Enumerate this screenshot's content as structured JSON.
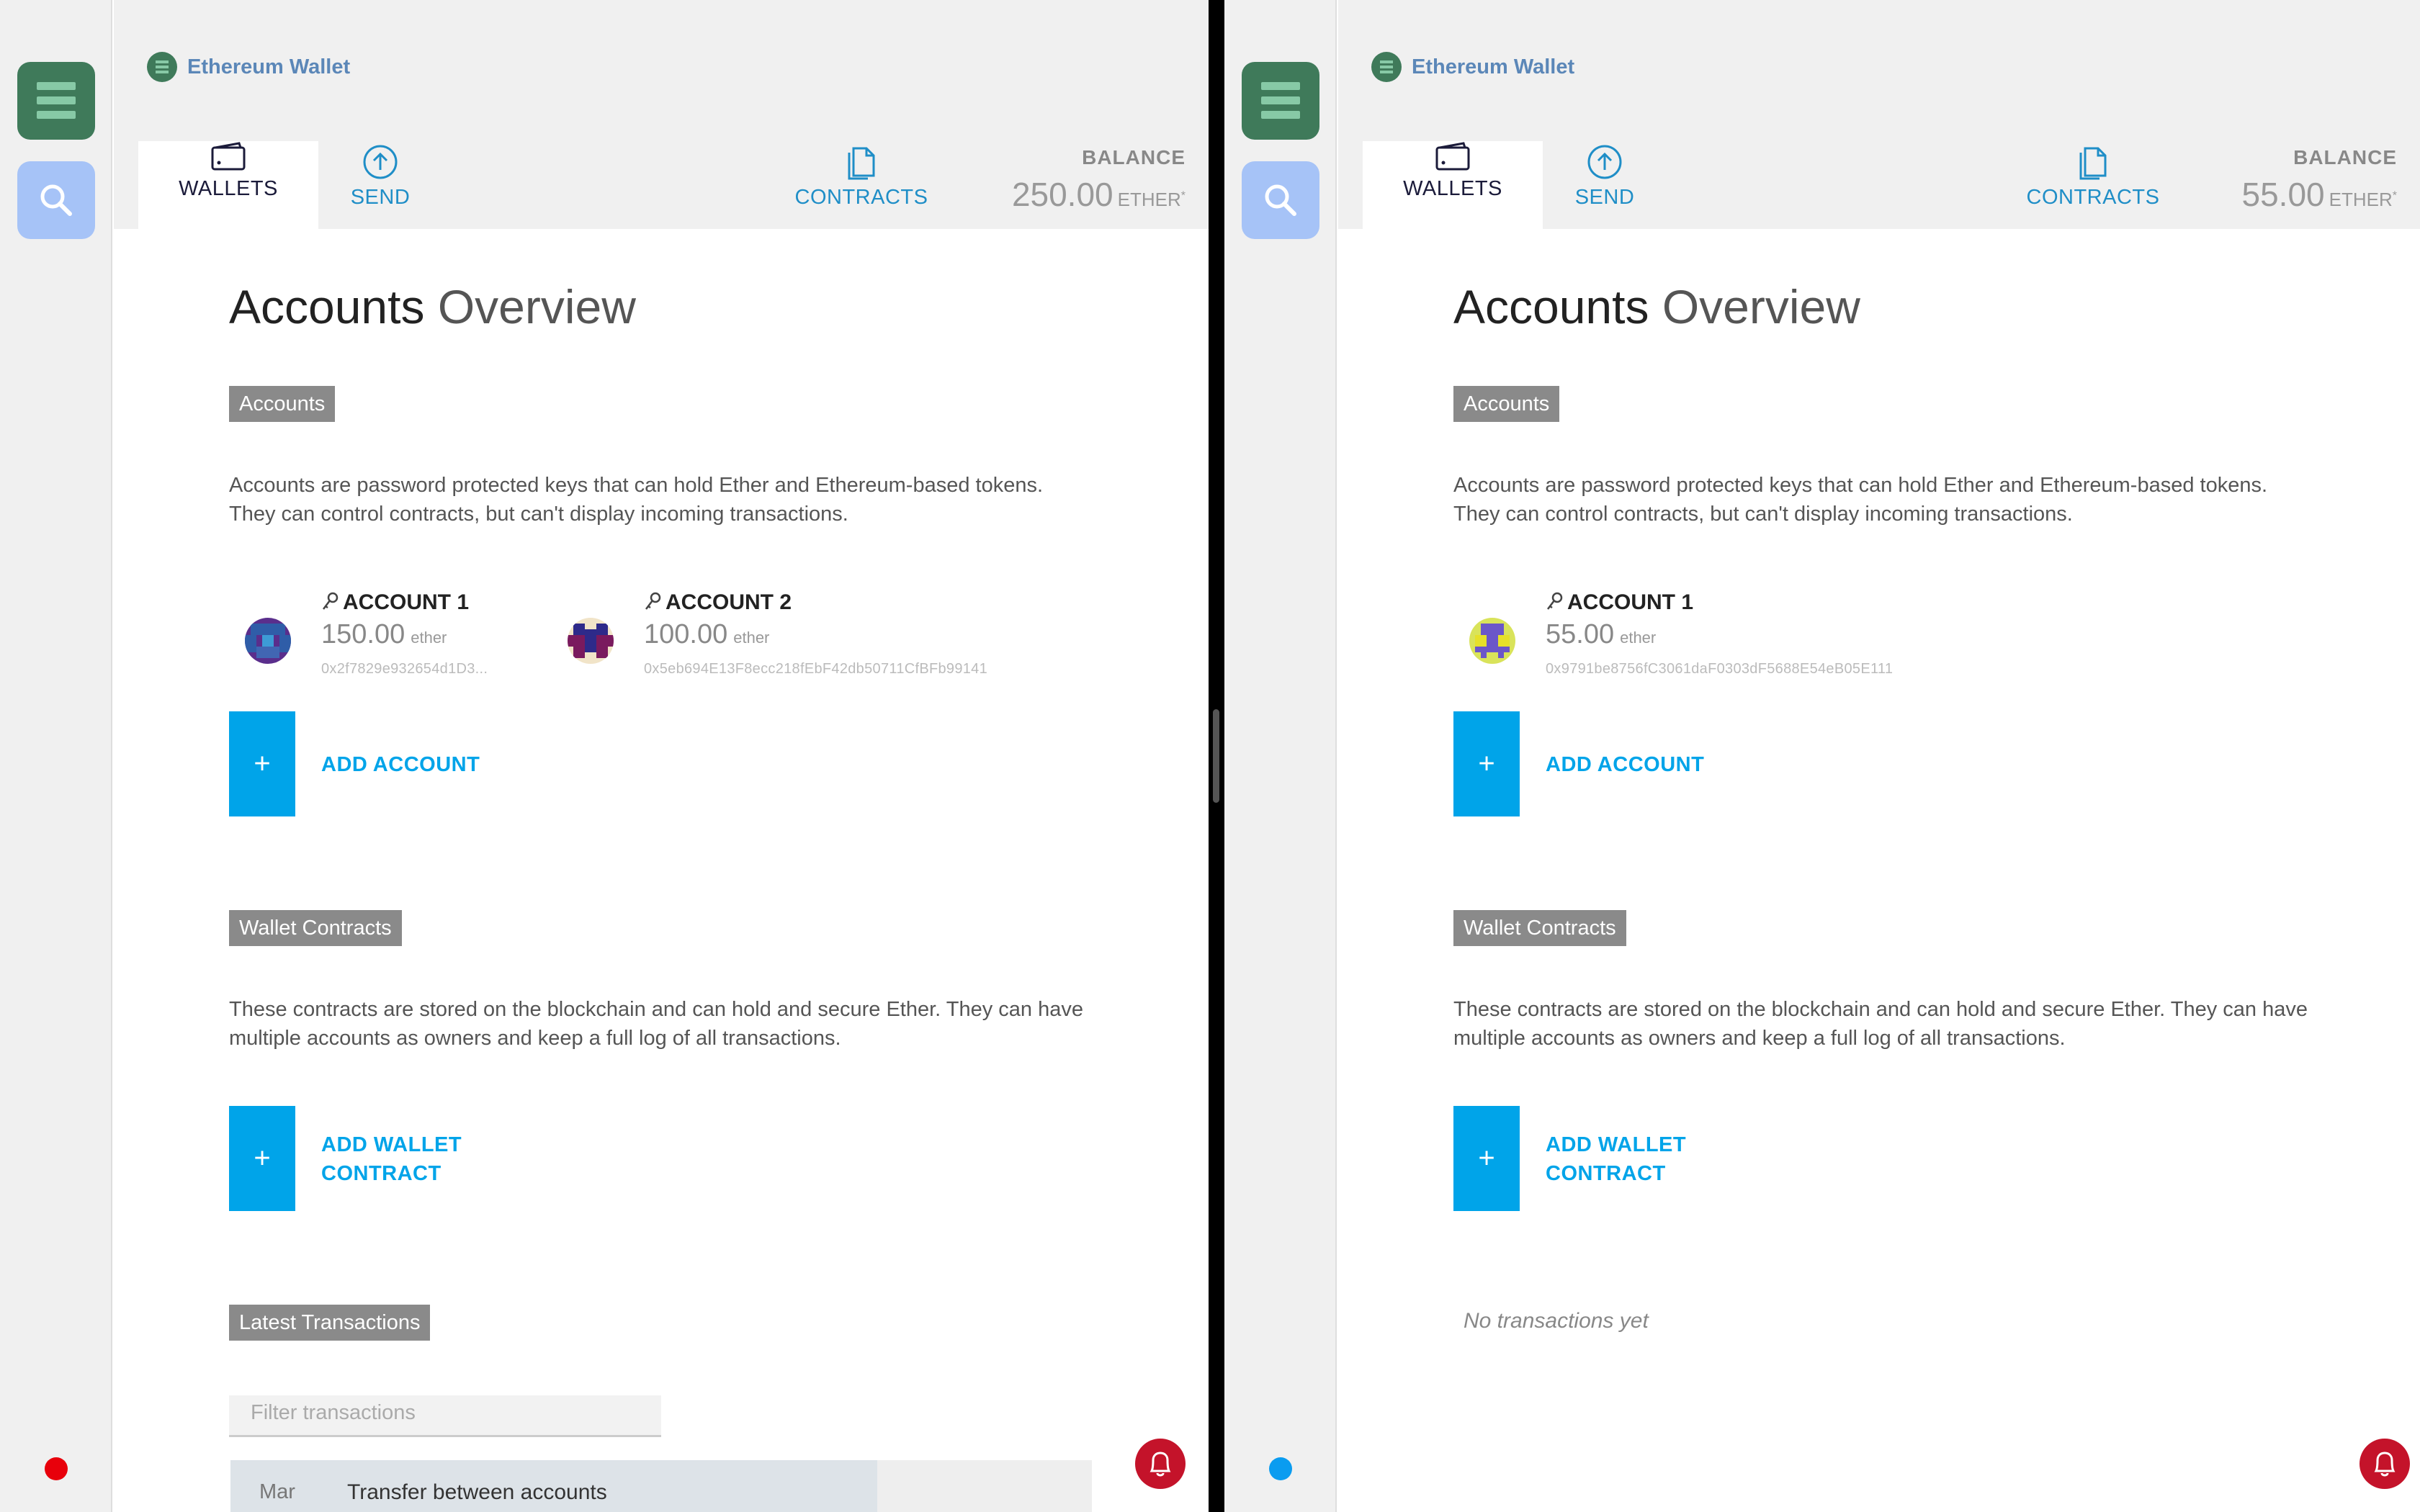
{
  "left": {
    "brand": "Ethereum Wallet",
    "nav": {
      "wallets": "WALLETS",
      "send": "SEND",
      "contracts": "CONTRACTS"
    },
    "balance": {
      "label": "BALANCE",
      "value": "250.00",
      "unit": "ETHER",
      "unit_mark": "*"
    },
    "title": {
      "bold": "Accounts",
      "light": "Overview"
    },
    "accounts_label": "Accounts",
    "accounts_desc": "Accounts are password protected keys that can hold Ether and Ethereum-based tokens. They can control contracts, but can't display incoming transactions.",
    "accounts": [
      {
        "name": "ACCOUNT 1",
        "amount": "150.00",
        "unit": "ether",
        "address": "0x2f7829e932654d1D3..."
      },
      {
        "name": "ACCOUNT 2",
        "amount": "100.00",
        "unit": "ether",
        "address": "0x5eb694E13F8ecc218fEbF42db50711CfBFb99141"
      }
    ],
    "add_account": "ADD ACCOUNT",
    "wallet_contracts_label": "Wallet Contracts",
    "wallet_contracts_desc": "These contracts are stored on the blockchain and can hold and secure Ether. They can have multiple accounts as owners and keep a full log of all transactions.",
    "add_wallet_contract": {
      "line1": "ADD WALLET",
      "line2": "CONTRACT"
    },
    "plus": "+",
    "latest_tx_label": "Latest Transactions",
    "filter_placeholder": "Filter transactions",
    "tx": [
      {
        "month": "Mar",
        "desc": "Transfer between accounts"
      }
    ],
    "status_color": "#e8000b"
  },
  "right": {
    "brand": "Ethereum Wallet",
    "nav": {
      "wallets": "WALLETS",
      "send": "SEND",
      "contracts": "CONTRACTS"
    },
    "balance": {
      "label": "BALANCE",
      "value": "55.00",
      "unit": "ETHER",
      "unit_mark": "*"
    },
    "title": {
      "bold": "Accounts",
      "light": "Overview"
    },
    "accounts_label": "Accounts",
    "accounts_desc": "Accounts are password protected keys that can hold Ether and Ethereum-based tokens. They can control contracts, but can't display incoming transactions.",
    "accounts": [
      {
        "name": "ACCOUNT 1",
        "amount": "55.00",
        "unit": "ether",
        "address": "0x9791be8756fC3061daF0303dF5688E54eB05E111"
      }
    ],
    "add_account": "ADD ACCOUNT",
    "wallet_contracts_label": "Wallet Contracts",
    "wallet_contracts_desc": "These contracts are stored on the blockchain and can hold and secure Ether. They can have multiple accounts as owners and keep a full log of all transactions.",
    "add_wallet_contract": {
      "line1": "ADD WALLET",
      "line2": "CONTRACT"
    },
    "plus": "+",
    "no_tx": "No transactions yet",
    "status_color": "#0a9cf0"
  },
  "colors": {
    "accent": "#00a4e9",
    "link": "#1f8ec7",
    "brand_green": "#3f7a5a",
    "notification": "#c4132a"
  }
}
